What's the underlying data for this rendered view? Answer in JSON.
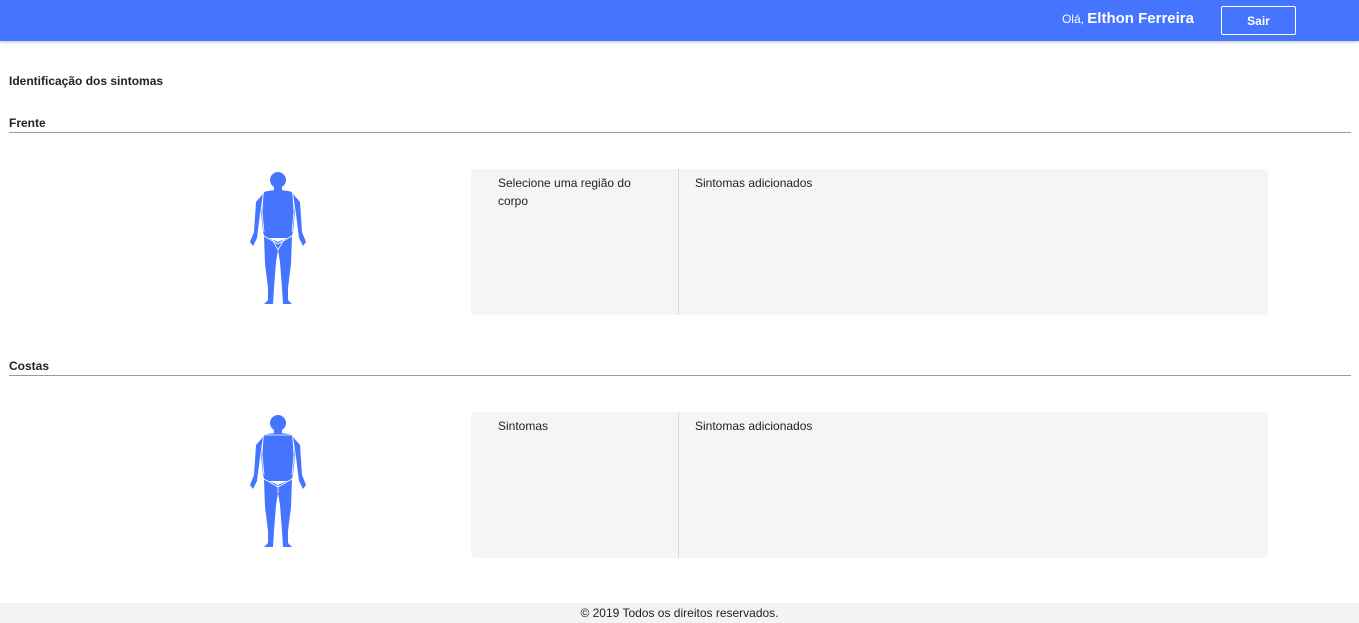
{
  "header": {
    "greeting": "Olá,",
    "user_name": "Elthon Ferreira",
    "logout_label": "Sair",
    "bar_color": "#4575ff"
  },
  "page": {
    "title": "Identificação dos sintomas"
  },
  "sections": [
    {
      "title": "Frente",
      "figure_icon": "human-body-front-icon",
      "left_label": "Selecione uma região do corpo",
      "right_label": "Sintomas adicionados"
    },
    {
      "title": "Costas",
      "figure_icon": "human-body-back-icon",
      "left_label": "Sintomas",
      "right_label": "Sintomas adicionados"
    }
  ],
  "footer": {
    "text": "© 2019 Todos os direitos reservados."
  }
}
